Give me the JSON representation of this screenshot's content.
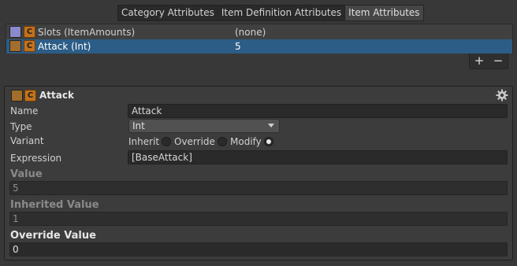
{
  "tabs": [
    {
      "label": "Category Attributes"
    },
    {
      "label": "Item Definition Attributes"
    },
    {
      "label": "Item Attributes"
    }
  ],
  "attributes": [
    {
      "name": "Slots (ItemAmounts)",
      "value": "(none)",
      "swatch_color": "#8a89cc",
      "icon": "C"
    },
    {
      "name": "Attack (Int)",
      "value": "5",
      "swatch_color": "#a36d2b",
      "icon": "C",
      "selected": true
    }
  ],
  "list_buttons": {
    "add": "+",
    "remove": "−"
  },
  "detail": {
    "title": "Attack",
    "icon": "C",
    "name_label": "Name",
    "name_value": "Attack",
    "type_label": "Type",
    "type_value": "Int",
    "variant_label": "Variant",
    "variant_options": [
      "Inherit",
      "Override",
      "Modify"
    ],
    "variant_selected": "Modify",
    "expression_label": "Expression",
    "expression_value": "[BaseAttack]",
    "value_title": "Value",
    "value_value": "5",
    "inherited_title": "Inherited Value",
    "inherited_value": "1",
    "override_title": "Override Value",
    "override_value": "0"
  },
  "colors": {
    "background": "#383838",
    "selection": "#2c5d87",
    "c_icon": "#c2721c"
  }
}
